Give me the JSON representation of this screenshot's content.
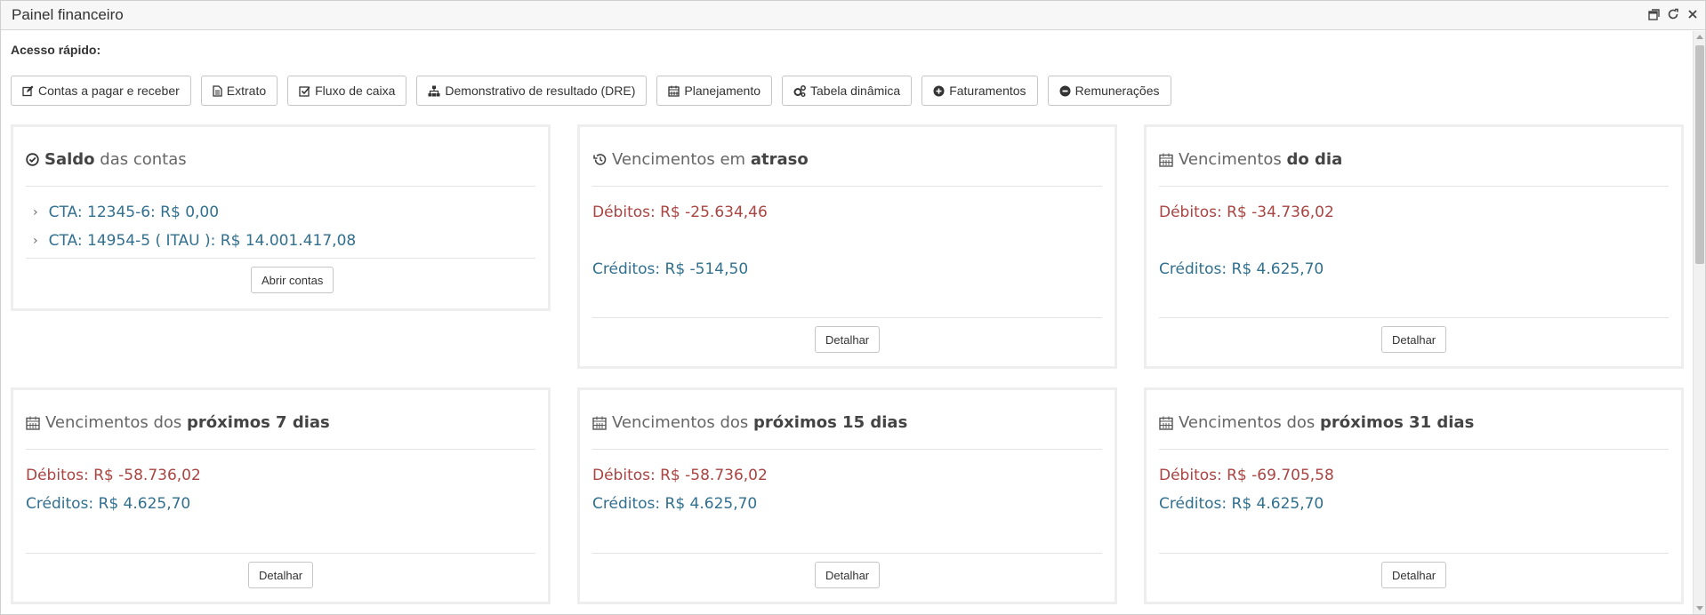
{
  "window": {
    "title": "Painel financeiro"
  },
  "quick_access": {
    "label": "Acesso rápido:",
    "buttons": [
      {
        "label": "Contas a pagar e receber",
        "icon": "edit-icon"
      },
      {
        "label": "Extrato",
        "icon": "file-icon"
      },
      {
        "label": "Fluxo de caixa",
        "icon": "check-square-icon"
      },
      {
        "label": "Demonstrativo de resultado (DRE)",
        "icon": "sitemap-icon"
      },
      {
        "label": "Planejamento",
        "icon": "calendar-icon"
      },
      {
        "label": "Tabela dinâmica",
        "icon": "cogs-icon"
      },
      {
        "label": "Faturamentos",
        "icon": "plus-circle-icon"
      },
      {
        "label": "Remunerações",
        "icon": "minus-circle-icon"
      }
    ]
  },
  "saldo": {
    "title_bold": "Saldo",
    "title_rest": "das contas",
    "accounts": [
      "CTA: 12345-6: R$ 0,00",
      "CTA: 14954-5 ( ITAU ): R$ 14.001.417,08"
    ],
    "button": "Abrir contas"
  },
  "atraso": {
    "title_plain": "Vencimentos em",
    "title_bold": "atraso",
    "debitos": "Débitos: R$ -25.634,46",
    "creditos": "Créditos: R$ -514,50",
    "button": "Detalhar"
  },
  "dia": {
    "title_plain": "Vencimentos",
    "title_bold": "do dia",
    "debitos": "Débitos: R$ -34.736,02",
    "creditos": "Créditos: R$ 4.625,70",
    "button": "Detalhar"
  },
  "prox7": {
    "title_plain": "Vencimentos dos",
    "title_bold": "próximos 7 dias",
    "debitos": "Débitos: R$ -58.736,02",
    "creditos": "Créditos: R$ 4.625,70",
    "button": "Detalhar"
  },
  "prox15": {
    "title_plain": "Vencimentos dos",
    "title_bold": "próximos 15 dias",
    "debitos": "Débitos: R$ -58.736,02",
    "creditos": "Créditos: R$ 4.625,70",
    "button": "Detalhar"
  },
  "prox31": {
    "title_plain": "Vencimentos dos",
    "title_bold": "próximos 31 dias",
    "debitos": "Débitos: R$ -69.705,58",
    "creditos": "Créditos: R$ 4.625,70",
    "button": "Detalhar"
  },
  "colors": {
    "debit": "#a94442",
    "credit": "#31708f"
  }
}
